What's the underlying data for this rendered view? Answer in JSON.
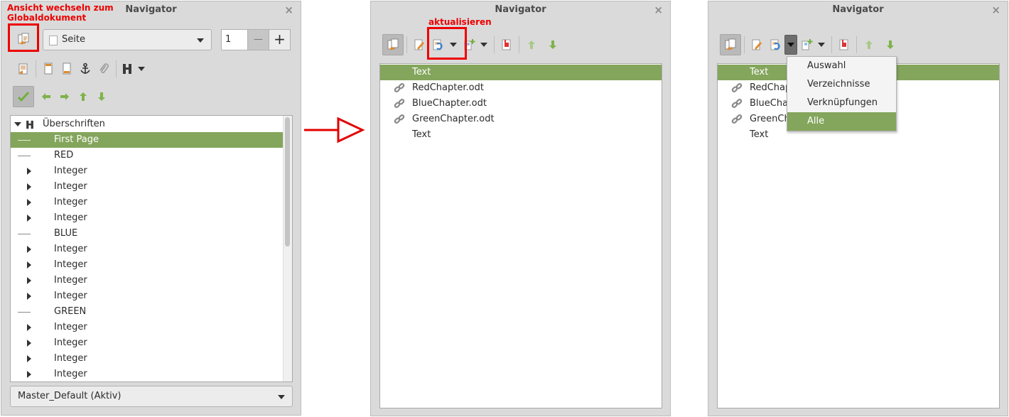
{
  "panels": {
    "title": "Navigator",
    "close": "×"
  },
  "annotations": {
    "switch_view": "Ansicht wechseln zum Globaldokument",
    "update": "aktualisieren"
  },
  "left": {
    "view_dropdown": "Seite",
    "page_number": "1",
    "minus": "—",
    "plus": "+",
    "heading_root": "Überschriften",
    "headings": [
      {
        "label": "First Page",
        "type": "leaf",
        "selected": true
      },
      {
        "label": "RED",
        "type": "leaf"
      },
      {
        "label": "Integer",
        "type": "collapsed"
      },
      {
        "label": "Integer",
        "type": "collapsed"
      },
      {
        "label": "Integer",
        "type": "collapsed"
      },
      {
        "label": "Integer",
        "type": "collapsed"
      },
      {
        "label": "BLUE",
        "type": "leaf"
      },
      {
        "label": "Integer",
        "type": "collapsed"
      },
      {
        "label": "Integer",
        "type": "collapsed"
      },
      {
        "label": "Integer",
        "type": "collapsed"
      },
      {
        "label": "Integer",
        "type": "collapsed"
      },
      {
        "label": "GREEN",
        "type": "leaf"
      },
      {
        "label": "Integer",
        "type": "collapsed"
      },
      {
        "label": "Integer",
        "type": "collapsed"
      },
      {
        "label": "Integer",
        "type": "collapsed"
      },
      {
        "label": "Integer",
        "type": "collapsed"
      }
    ],
    "document_dropdown": "Master_Default (Aktiv)"
  },
  "global_items": [
    {
      "label": "Text",
      "link": false,
      "selected": true
    },
    {
      "label": "RedChapter.odt",
      "link": true
    },
    {
      "label": "BlueChapter.odt",
      "link": true
    },
    {
      "label": "GreenChapter.odt",
      "link": true
    },
    {
      "label": "Text",
      "link": false
    }
  ],
  "right_items_visible": [
    "Text",
    "RedChap",
    "BlueChap",
    "GreenCh",
    "Text"
  ],
  "update_menu": [
    {
      "label": "Auswahl"
    },
    {
      "label": "Verzeichnisse"
    },
    {
      "label": "Verknüpfungen"
    },
    {
      "label": "Alle",
      "selected": true
    }
  ],
  "colors": {
    "accent": "#84a55c",
    "annotation": "#ee0000"
  }
}
